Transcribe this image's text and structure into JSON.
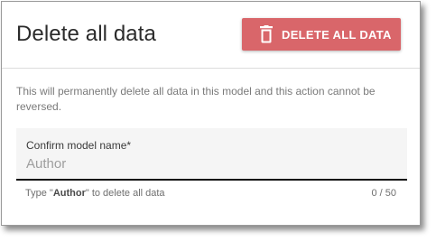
{
  "dialog": {
    "title": "Delete all data",
    "delete_button": {
      "label": "DELETE ALL DATA",
      "icon": "trash-icon",
      "color": "#d9666a"
    },
    "warning": "This will permanently delete all data in this model and this action cannot be reversed.",
    "field": {
      "label": "Confirm model name*",
      "value": "",
      "placeholder": "Author"
    },
    "helper": {
      "prefix": "Type \"",
      "model_name": "Author",
      "suffix": "\" to delete all data"
    },
    "counter": "0 / 50"
  }
}
